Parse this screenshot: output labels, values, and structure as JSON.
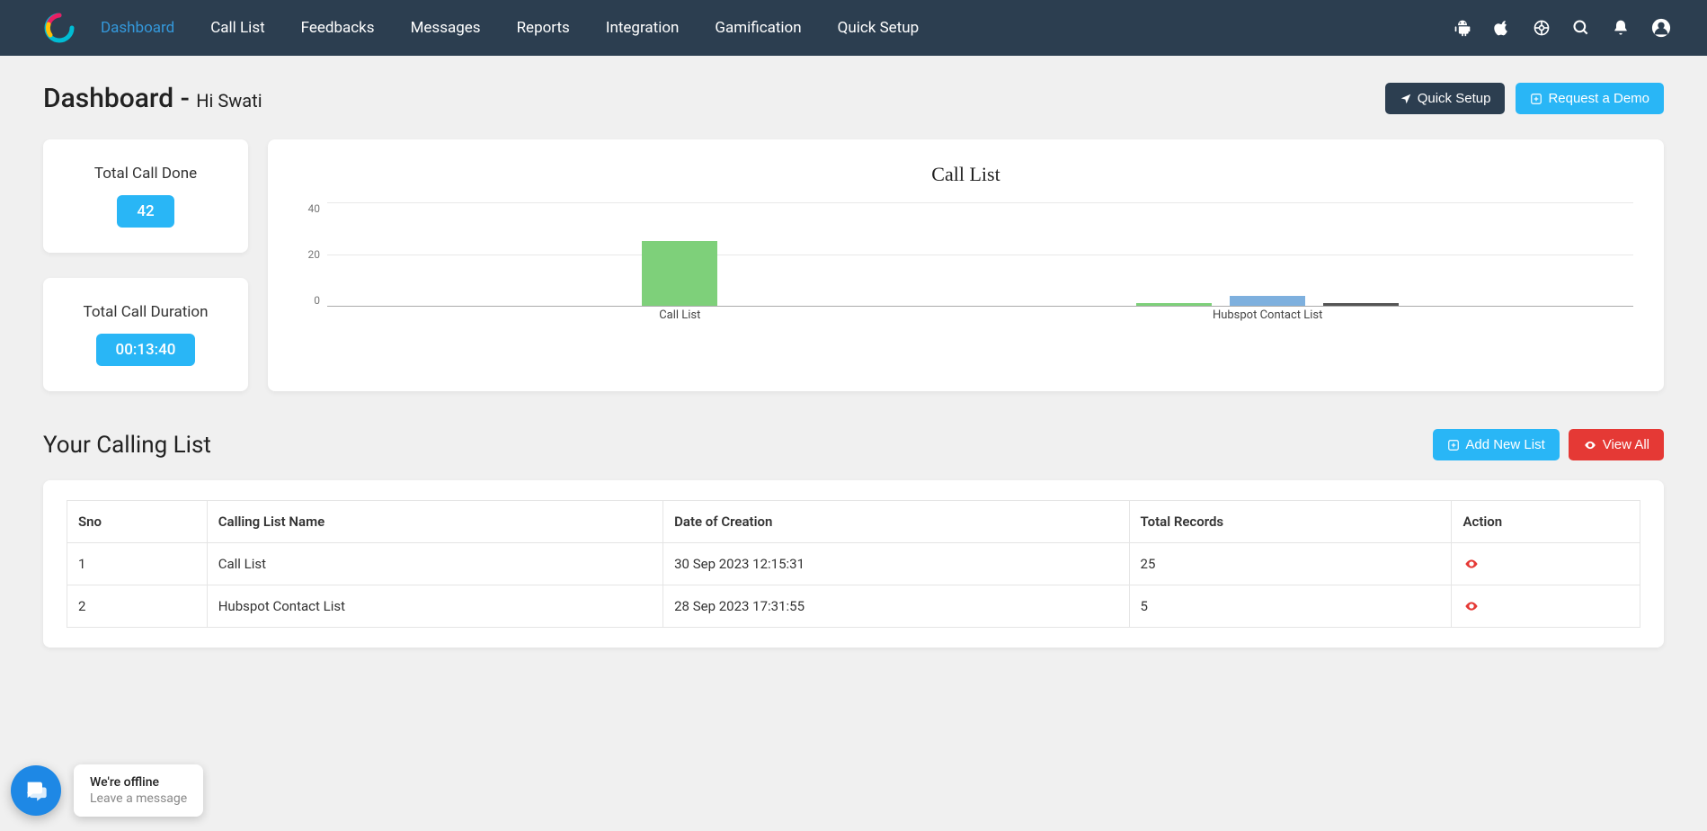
{
  "nav": {
    "items": [
      "Dashboard",
      "Call List",
      "Feedbacks",
      "Messages",
      "Reports",
      "Integration",
      "Gamification",
      "Quick Setup"
    ],
    "active_index": 0
  },
  "header": {
    "title": "Dashboard -",
    "greeting": "Hi Swati",
    "quick_setup": "Quick Setup",
    "request_demo": "Request a Demo"
  },
  "stats": {
    "total_calls_label": "Total Call Done",
    "total_calls_value": "42",
    "total_duration_label": "Total Call Duration",
    "total_duration_value": "00:13:40"
  },
  "chart_data": {
    "type": "bar",
    "title": "Call List",
    "categories": [
      "Call List",
      "Hubspot Contact List"
    ],
    "series": [
      {
        "name": "green",
        "color": "#7ed07a",
        "values": [
          25,
          1
        ]
      },
      {
        "name": "blue",
        "color": "#7eb0de",
        "values": [
          0,
          4
        ]
      },
      {
        "name": "dark",
        "color": "#555555",
        "values": [
          0,
          1
        ]
      }
    ],
    "y_ticks": [
      "40",
      "20",
      "0"
    ],
    "ylim": [
      0,
      40
    ]
  },
  "calling_list": {
    "title": "Your Calling List",
    "add_new": "Add New List",
    "view_all": "View All",
    "columns": [
      "Sno",
      "Calling List Name",
      "Date of Creation",
      "Total Records",
      "Action"
    ],
    "rows": [
      {
        "sno": "1",
        "name": "Call List",
        "date": "30 Sep 2023 12:15:31",
        "records": "25"
      },
      {
        "sno": "2",
        "name": "Hubspot Contact List",
        "date": "28 Sep 2023 17:31:55",
        "records": "5"
      }
    ]
  },
  "chat": {
    "title": "We're offline",
    "subtitle": "Leave a message"
  }
}
